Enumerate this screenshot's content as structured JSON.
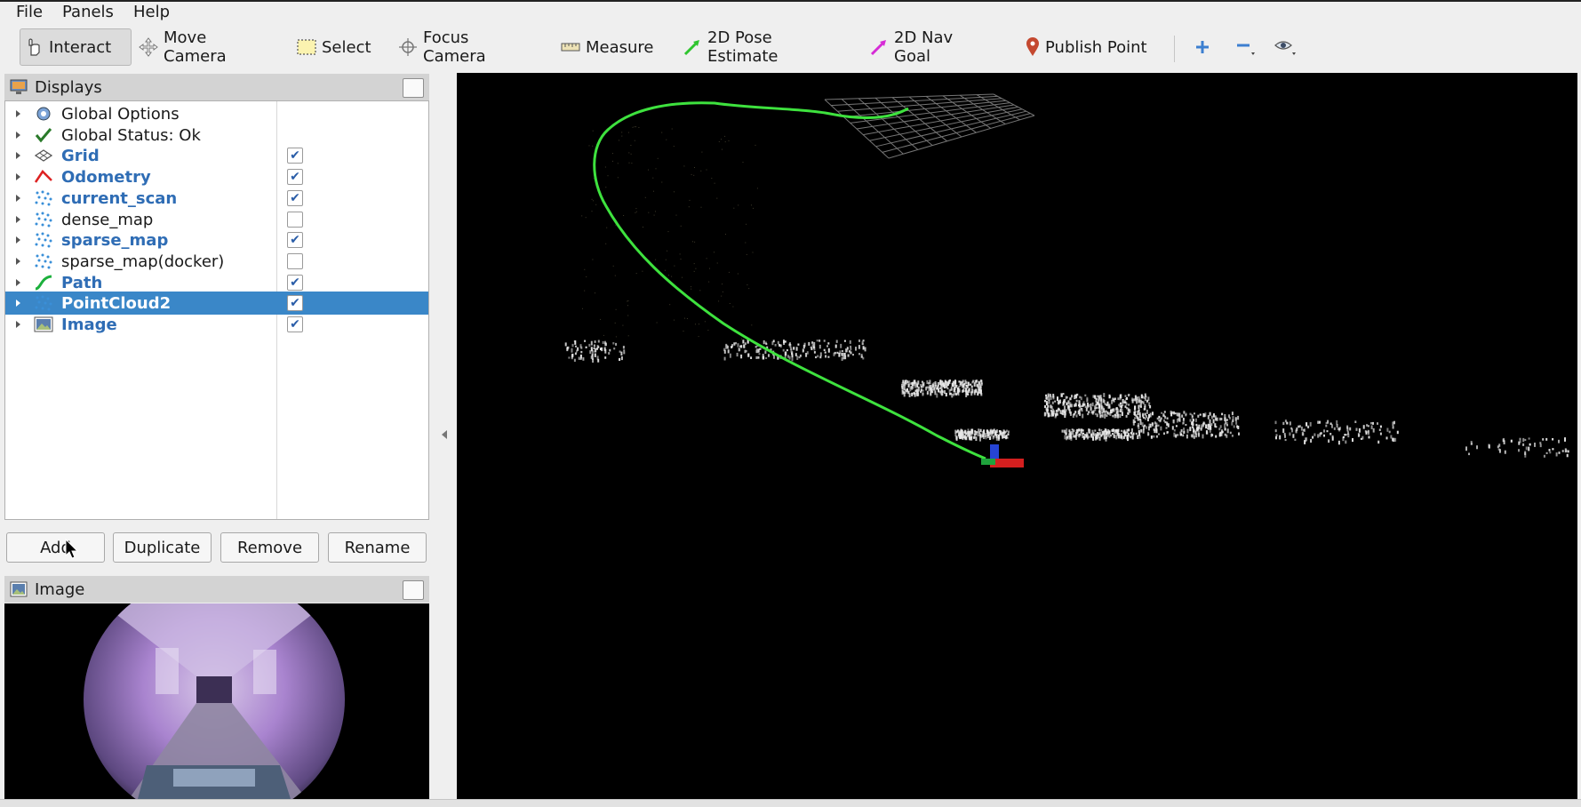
{
  "menu": {
    "file": "File",
    "panels": "Panels",
    "help": "Help"
  },
  "toolbar": {
    "interact": "Interact",
    "move_camera": "Move Camera",
    "select": "Select",
    "focus_camera": "Focus Camera",
    "measure": "Measure",
    "pose_estimate": "2D Pose Estimate",
    "nav_goal": "2D Nav Goal",
    "publish_point": "Publish Point"
  },
  "displays_panel": {
    "title": "Displays",
    "items": [
      {
        "label": "Global Options",
        "checked": null,
        "bold": false,
        "icon": "gear-icon"
      },
      {
        "label": "Global Status: Ok",
        "checked": null,
        "bold": false,
        "icon": "checkmark-icon"
      },
      {
        "label": "Grid",
        "checked": true,
        "bold": true,
        "icon": "grid-icon"
      },
      {
        "label": "Odometry",
        "checked": true,
        "bold": true,
        "icon": "odometry-icon"
      },
      {
        "label": "current_scan",
        "checked": true,
        "bold": true,
        "icon": "pointcloud-icon"
      },
      {
        "label": "dense_map",
        "checked": false,
        "bold": false,
        "icon": "pointcloud-icon"
      },
      {
        "label": "sparse_map",
        "checked": true,
        "bold": true,
        "icon": "pointcloud-icon"
      },
      {
        "label": "sparse_map(docker)",
        "checked": false,
        "bold": false,
        "icon": "pointcloud-icon"
      },
      {
        "label": "Path",
        "checked": true,
        "bold": true,
        "icon": "path-icon"
      },
      {
        "label": "PointCloud2",
        "checked": true,
        "bold": true,
        "icon": "pointcloud-icon",
        "selected": true
      },
      {
        "label": "Image",
        "checked": true,
        "bold": true,
        "icon": "image-icon"
      }
    ],
    "buttons": {
      "add": "Add",
      "duplicate": "Duplicate",
      "remove": "Remove",
      "rename": "Rename"
    }
  },
  "image_panel": {
    "title": "Image"
  },
  "colors": {
    "selection": "#3a87c8",
    "path_green": "#3ee23e",
    "bold_label": "#2f6db5"
  }
}
